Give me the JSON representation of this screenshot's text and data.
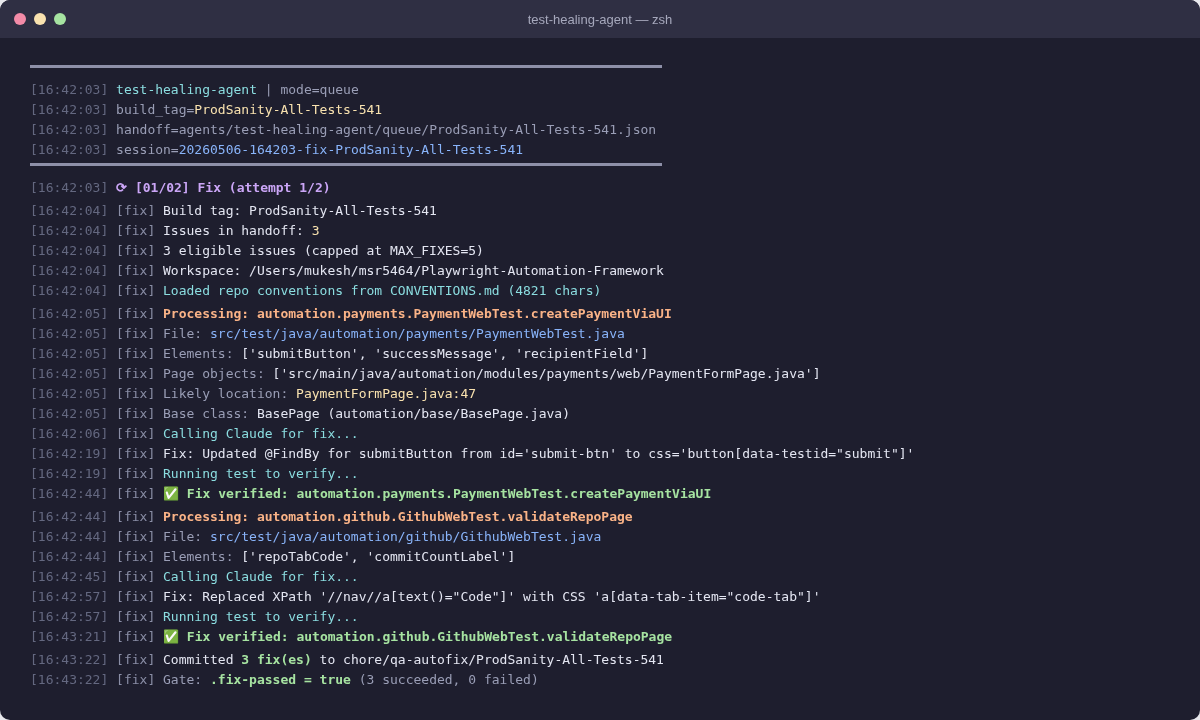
{
  "window": {
    "title": "test-healing-agent — zsh"
  },
  "blocks": [
    {
      "kind": "rule"
    },
    {
      "kind": "lines",
      "lines": [
        {
          "time": "[16:42:03]",
          "segments": [
            {
              "text": "test-healing-agent",
              "kind": "info"
            },
            {
              "text": " | mode=queue",
              "kind": "label"
            }
          ]
        },
        {
          "time": "[16:42:03]",
          "segments": [
            {
              "text": "build_tag=",
              "kind": "label"
            },
            {
              "text": "ProdSanity-All-Tests-541",
              "kind": "value"
            }
          ]
        },
        {
          "time": "[16:42:03]",
          "segments": [
            {
              "text": "handoff=agents/test-healing-agent/queue/ProdSanity-All-Tests-541.json",
              "kind": "label"
            }
          ]
        },
        {
          "time": "[16:42:03]",
          "segments": [
            {
              "text": "session=",
              "kind": "label"
            },
            {
              "text": "20260506-164203-fix-ProdSanity-All-Tests-541",
              "kind": "path"
            }
          ]
        }
      ]
    },
    {
      "kind": "rule"
    },
    {
      "kind": "lines",
      "lines": [
        {
          "time": "[16:42:03]",
          "segments": [
            {
              "text": "⟳ [01/02] Fix (attempt 1/2)",
              "kind": "step"
            }
          ]
        }
      ]
    },
    {
      "kind": "lines",
      "lines": [
        {
          "time": "[16:42:04]",
          "tag": "[fix]",
          "segments": [
            {
              "text": "Build tag: ProdSanity-All-Tests-541",
              "kind": "text"
            }
          ]
        },
        {
          "time": "[16:42:04]",
          "tag": "[fix]",
          "segments": [
            {
              "text": "Issues in handoff: ",
              "kind": "text"
            },
            {
              "text": "3",
              "kind": "value"
            }
          ]
        },
        {
          "time": "[16:42:04]",
          "tag": "[fix]",
          "segments": [
            {
              "text": "3 eligible issues (capped at MAX_FIXES=5)",
              "kind": "text"
            }
          ]
        },
        {
          "time": "[16:42:04]",
          "tag": "[fix]",
          "segments": [
            {
              "text": "Workspace: /Users/mukesh/msr5464/Playwright-Automation-Framework",
              "kind": "text"
            }
          ]
        },
        {
          "time": "[16:42:04]",
          "tag": "[fix]",
          "segments": [
            {
              "text": "Loaded repo conventions from CONVENTIONS.md (4821 chars)",
              "kind": "info"
            }
          ]
        }
      ]
    },
    {
      "kind": "lines",
      "lines": [
        {
          "time": "[16:42:05]",
          "tag": "[fix]",
          "segments": [
            {
              "text": "Processing: automation.payments.PaymentWebTest.createPaymentViaUI",
              "kind": "processing"
            }
          ]
        },
        {
          "time": "[16:42:05]",
          "tag": "[fix]",
          "segments": [
            {
              "text": "File: ",
              "kind": "label"
            },
            {
              "text": "src/test/java/automation/payments/PaymentWebTest.java",
              "kind": "path"
            }
          ]
        },
        {
          "time": "[16:42:05]",
          "tag": "[fix]",
          "segments": [
            {
              "text": "Elements: ",
              "kind": "label"
            },
            {
              "text": "['submitButton', 'successMessage', 'recipientField']",
              "kind": "text"
            }
          ]
        },
        {
          "time": "[16:42:05]",
          "tag": "[fix]",
          "segments": [
            {
              "text": "Page objects: ",
              "kind": "label"
            },
            {
              "text": "['src/main/java/automation/modules/payments/web/PaymentFormPage.java']",
              "kind": "text"
            }
          ]
        },
        {
          "time": "[16:42:05]",
          "tag": "[fix]",
          "segments": [
            {
              "text": "Likely location: ",
              "kind": "label"
            },
            {
              "text": "PaymentFormPage.java:47",
              "kind": "value"
            }
          ]
        },
        {
          "time": "[16:42:05]",
          "tag": "[fix]",
          "segments": [
            {
              "text": "Base class: ",
              "kind": "label"
            },
            {
              "text": "BasePage (automation/base/BasePage.java)",
              "kind": "text"
            }
          ]
        },
        {
          "time": "[16:42:06]",
          "tag": "[fix]",
          "segments": [
            {
              "text": "Calling Claude for fix...",
              "kind": "info"
            }
          ]
        },
        {
          "time": "[16:42:19]",
          "tag": "[fix]",
          "segments": [
            {
              "text": "Fix: Updated @FindBy for submitButton from id='submit-btn' to css='button[data-testid=\"submit\"]'",
              "kind": "text"
            }
          ]
        },
        {
          "time": "[16:42:19]",
          "tag": "[fix]",
          "segments": [
            {
              "text": "Running test to verify...",
              "kind": "info"
            }
          ]
        },
        {
          "time": "[16:42:44]",
          "tag": "[fix]",
          "segments": [
            {
              "text": "✅ Fix verified: automation.payments.PaymentWebTest.createPaymentViaUI",
              "kind": "success"
            }
          ]
        }
      ]
    },
    {
      "kind": "lines",
      "lines": [
        {
          "time": "[16:42:44]",
          "tag": "[fix]",
          "segments": [
            {
              "text": "Processing: automation.github.GithubWebTest.validateRepoPage",
              "kind": "processing"
            }
          ]
        },
        {
          "time": "[16:42:44]",
          "tag": "[fix]",
          "segments": [
            {
              "text": "File: ",
              "kind": "label"
            },
            {
              "text": "src/test/java/automation/github/GithubWebTest.java",
              "kind": "path"
            }
          ]
        },
        {
          "time": "[16:42:44]",
          "tag": "[fix]",
          "segments": [
            {
              "text": "Elements: ",
              "kind": "label"
            },
            {
              "text": "['repoTabCode', 'commitCountLabel']",
              "kind": "text"
            }
          ]
        },
        {
          "time": "[16:42:45]",
          "tag": "[fix]",
          "segments": [
            {
              "text": "Calling Claude for fix...",
              "kind": "info"
            }
          ]
        },
        {
          "time": "[16:42:57]",
          "tag": "[fix]",
          "segments": [
            {
              "text": "Fix: Replaced XPath '//nav//a[text()=\"Code\"]' with CSS 'a[data-tab-item=\"code-tab\"]'",
              "kind": "text"
            }
          ]
        },
        {
          "time": "[16:42:57]",
          "tag": "[fix]",
          "segments": [
            {
              "text": "Running test to verify...",
              "kind": "info"
            }
          ]
        },
        {
          "time": "[16:43:21]",
          "tag": "[fix]",
          "segments": [
            {
              "text": "✅ Fix verified: automation.github.GithubWebTest.validateRepoPage",
              "kind": "success"
            }
          ]
        }
      ]
    },
    {
      "kind": "lines",
      "lines": [
        {
          "time": "[16:43:22]",
          "tag": "[fix]",
          "segments": [
            {
              "text": "Committed ",
              "kind": "text"
            },
            {
              "text": "3 fix(es)",
              "kind": "success"
            },
            {
              "text": " to chore/qa-autofix/ProdSanity-All-Tests-541",
              "kind": "text"
            }
          ]
        },
        {
          "time": "[16:43:22]",
          "tag": "[fix]",
          "segments": [
            {
              "text": "Gate: ",
              "kind": "label"
            },
            {
              "text": ".fix-passed = true",
              "kind": "success"
            },
            {
              "text": " (3 succeeded, 0 failed)",
              "kind": "label"
            }
          ]
        }
      ]
    }
  ]
}
